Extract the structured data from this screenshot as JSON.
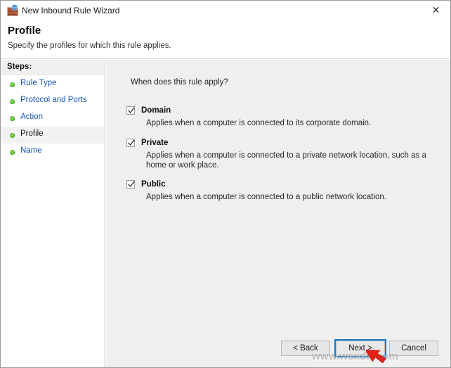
{
  "window": {
    "title": "New Inbound Rule Wizard",
    "icon": "firewall-brickwall-globe-icon",
    "close_label": "✕"
  },
  "header": {
    "title": "Profile",
    "subtitle": "Specify the profiles for which this rule applies."
  },
  "sidebar": {
    "heading": "Steps:",
    "items": [
      {
        "label": "Rule Type",
        "state": "completed"
      },
      {
        "label": "Protocol and Ports",
        "state": "completed"
      },
      {
        "label": "Action",
        "state": "completed"
      },
      {
        "label": "Profile",
        "state": "current"
      },
      {
        "label": "Name",
        "state": "pending"
      }
    ]
  },
  "main": {
    "question": "When does this rule apply?",
    "options": [
      {
        "label": "Domain",
        "checked": true,
        "description": "Applies when a computer is connected to its corporate domain."
      },
      {
        "label": "Private",
        "checked": true,
        "description": "Applies when a computer is connected to a private network location, such as a home or work place."
      },
      {
        "label": "Public",
        "checked": true,
        "description": "Applies when a computer is connected to a public network location."
      }
    ]
  },
  "buttons": {
    "back": "< Back",
    "next": "Next >",
    "cancel": "Cancel",
    "focused": "next"
  },
  "overlay": {
    "watermark": "www.wsxdn.com",
    "cursor": "red-arrow-cursor"
  },
  "colors": {
    "link": "#1757b8",
    "bullet_green": "#5fc13b",
    "focus_blue": "#1679c8",
    "panel_bg": "#efefef",
    "cursor_red": "#e2231a"
  }
}
